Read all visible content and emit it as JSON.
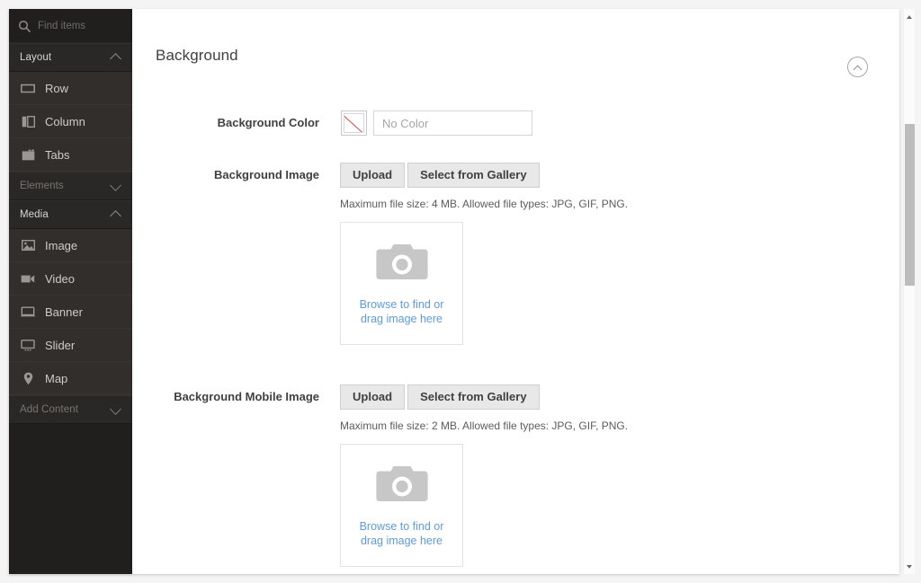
{
  "sidebar": {
    "search": {
      "icon": "search-icon",
      "placeholder": "Find items",
      "value": ""
    },
    "groups": [
      {
        "label": "Layout",
        "icon": "chevron-up-icon",
        "expanded": true,
        "dim": false,
        "items": [
          {
            "label": "Row",
            "icon": "row-icon"
          },
          {
            "label": "Column",
            "icon": "column-icon"
          },
          {
            "label": "Tabs",
            "icon": "tabs-icon"
          }
        ]
      },
      {
        "label": "Elements",
        "icon": "chevron-down-icon",
        "expanded": false,
        "dim": true,
        "items": []
      },
      {
        "label": "Media",
        "icon": "chevron-up-icon",
        "expanded": true,
        "dim": false,
        "items": [
          {
            "label": "Image",
            "icon": "image-icon"
          },
          {
            "label": "Video",
            "icon": "video-icon"
          },
          {
            "label": "Banner",
            "icon": "banner-icon"
          },
          {
            "label": "Slider",
            "icon": "slider-icon"
          },
          {
            "label": "Map",
            "icon": "map-pin-icon"
          }
        ]
      },
      {
        "label": "Add Content",
        "icon": "chevron-down-icon",
        "expanded": false,
        "dim": true,
        "items": []
      }
    ]
  },
  "panel": {
    "title": "Background",
    "collapse_icon": "chevron-up-circle-icon",
    "fields": {
      "background_color": {
        "label": "Background Color",
        "swatch_icon": "no-color-swatch-icon",
        "input_placeholder": "No Color",
        "input_value": ""
      },
      "background_image": {
        "label": "Background Image",
        "upload_label": "Upload",
        "gallery_label": "Select from Gallery",
        "note": "Maximum file size: 4 MB. Allowed file types: JPG, GIF, PNG.",
        "dropzone": {
          "icon": "camera-icon",
          "line1": "Browse to find or",
          "line2": "drag image here"
        }
      },
      "background_mobile_image": {
        "label": "Background Mobile Image",
        "upload_label": "Upload",
        "gallery_label": "Select from Gallery",
        "note": "Maximum file size: 2 MB. Allowed file types: JPG, GIF, PNG.",
        "dropzone": {
          "icon": "camera-icon",
          "line1": "Browse to find or",
          "line2": "drag image here"
        }
      }
    }
  },
  "scrollbar": {
    "up_icon": "triangle-up-icon",
    "down_icon": "triangle-down-icon",
    "thumb": "scrollbar-thumb"
  },
  "colors": {
    "sidebar_bg": "#211f1e",
    "sidebar_item_bg": "#312e2c",
    "link_blue": "#5f9bd8",
    "button_bg": "#e8e8e8",
    "no_color_slash": "#d04a4a",
    "text_dark": "#41403f"
  }
}
